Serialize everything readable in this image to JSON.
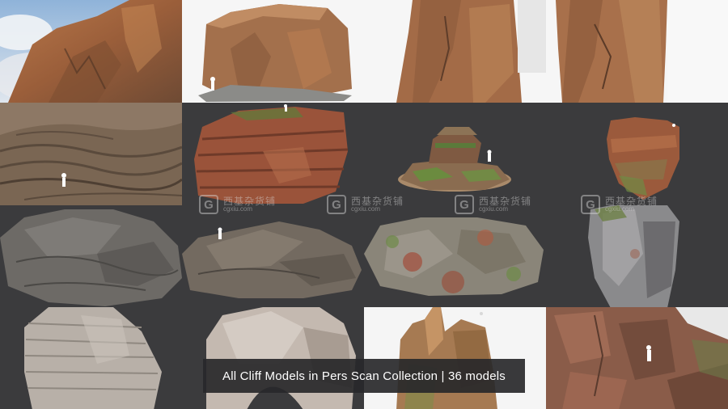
{
  "caption": "All Cliff Models in Pers Scan Collection | 36 models",
  "watermark": {
    "logo_letter": "G",
    "brand": "西基杂货铺",
    "domain": "cgxiu.com"
  },
  "tiles": [
    {
      "subject": "cliff-face-sky"
    },
    {
      "subject": "rock-plateau-white"
    },
    {
      "subject": "rock-pillar-white"
    },
    {
      "subject": "rock-pillar-white"
    },
    {
      "subject": "layered-rock-ground"
    },
    {
      "subject": "red-sandstone-block"
    },
    {
      "subject": "mossy-rock-stack"
    },
    {
      "subject": "rock-boulder-mossy"
    },
    {
      "subject": "grey-rock-slab"
    },
    {
      "subject": "grey-rock-mound"
    },
    {
      "subject": "lichen-rock-mass"
    },
    {
      "subject": "grey-cliff-chunk"
    },
    {
      "subject": "pale-layered-rock"
    },
    {
      "subject": "pale-rock-arch"
    },
    {
      "subject": "sandstone-tower"
    },
    {
      "subject": "red-cliff-wall"
    }
  ]
}
